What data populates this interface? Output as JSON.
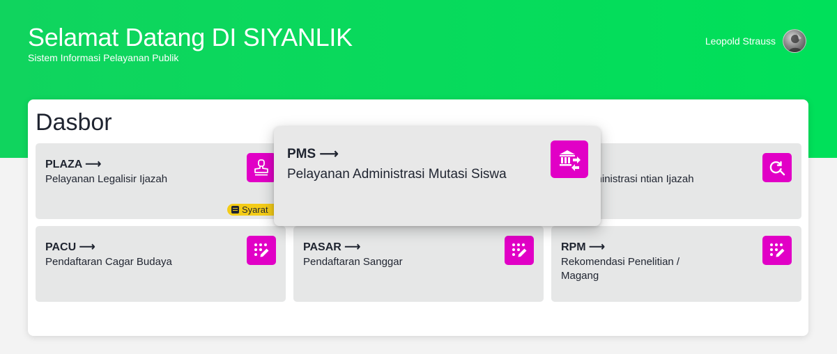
{
  "header": {
    "title": "Selamat Datang DI SIYANLIK",
    "subtitle": "Sistem Informasi Pelayanan Publik",
    "user_name": "Leopold Strauss"
  },
  "dashboard": {
    "title": "Dasbor",
    "cards": [
      {
        "code": "PLAZA",
        "arrow": "⟶",
        "description": "Pelayanan Legalisir Ijazah",
        "icon": "stamp-icon",
        "badge": "Syarat"
      },
      {
        "code": "",
        "arrow": "⟶",
        "description": "an Administrasi ntian Ijazah",
        "icon": "search-refresh-icon"
      },
      {
        "code": "PACU",
        "arrow": "⟶",
        "description": "Pendaftaran Cagar Budaya",
        "icon": "keypad-edit-icon"
      },
      {
        "code": "PASAR",
        "arrow": "⟶",
        "description": "Pendaftaran Sanggar",
        "icon": "keypad-edit-icon"
      },
      {
        "code": "RPM",
        "arrow": "⟶",
        "description": "Rekomendasi Penelitian / Magang",
        "icon": "keypad-edit-icon"
      }
    ]
  },
  "popover": {
    "code": "PMS",
    "arrow": "⟶",
    "description": "Pelayanan Administrasi Mutasi Siswa",
    "icon": "bank-transfer-icon"
  },
  "colors": {
    "header_green": "#00e05a",
    "icon_magenta": "#e100c6",
    "badge_yellow": "#f4cc17",
    "card_gray": "#e6e7e7"
  }
}
